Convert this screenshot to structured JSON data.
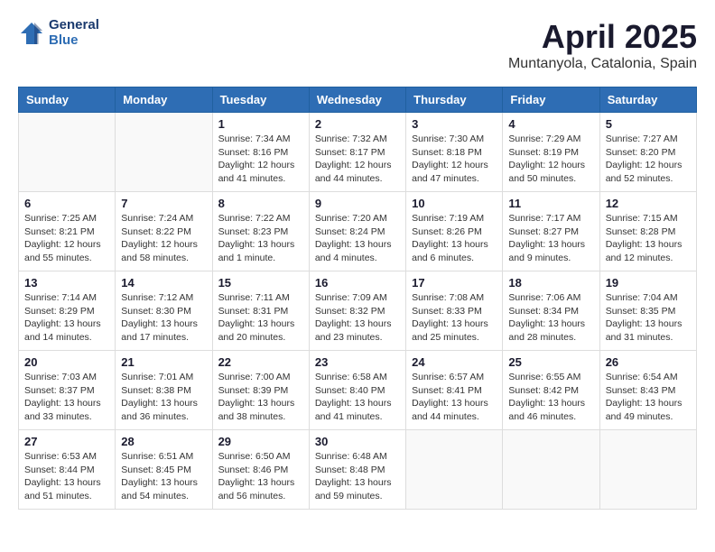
{
  "header": {
    "logo_line1": "General",
    "logo_line2": "Blue",
    "title": "April 2025",
    "subtitle": "Muntanyola, Catalonia, Spain"
  },
  "weekdays": [
    "Sunday",
    "Monday",
    "Tuesday",
    "Wednesday",
    "Thursday",
    "Friday",
    "Saturday"
  ],
  "weeks": [
    [
      {
        "day": "",
        "info": ""
      },
      {
        "day": "",
        "info": ""
      },
      {
        "day": "1",
        "info": "Sunrise: 7:34 AM\nSunset: 8:16 PM\nDaylight: 12 hours and 41 minutes."
      },
      {
        "day": "2",
        "info": "Sunrise: 7:32 AM\nSunset: 8:17 PM\nDaylight: 12 hours and 44 minutes."
      },
      {
        "day": "3",
        "info": "Sunrise: 7:30 AM\nSunset: 8:18 PM\nDaylight: 12 hours and 47 minutes."
      },
      {
        "day": "4",
        "info": "Sunrise: 7:29 AM\nSunset: 8:19 PM\nDaylight: 12 hours and 50 minutes."
      },
      {
        "day": "5",
        "info": "Sunrise: 7:27 AM\nSunset: 8:20 PM\nDaylight: 12 hours and 52 minutes."
      }
    ],
    [
      {
        "day": "6",
        "info": "Sunrise: 7:25 AM\nSunset: 8:21 PM\nDaylight: 12 hours and 55 minutes."
      },
      {
        "day": "7",
        "info": "Sunrise: 7:24 AM\nSunset: 8:22 PM\nDaylight: 12 hours and 58 minutes."
      },
      {
        "day": "8",
        "info": "Sunrise: 7:22 AM\nSunset: 8:23 PM\nDaylight: 13 hours and 1 minute."
      },
      {
        "day": "9",
        "info": "Sunrise: 7:20 AM\nSunset: 8:24 PM\nDaylight: 13 hours and 4 minutes."
      },
      {
        "day": "10",
        "info": "Sunrise: 7:19 AM\nSunset: 8:26 PM\nDaylight: 13 hours and 6 minutes."
      },
      {
        "day": "11",
        "info": "Sunrise: 7:17 AM\nSunset: 8:27 PM\nDaylight: 13 hours and 9 minutes."
      },
      {
        "day": "12",
        "info": "Sunrise: 7:15 AM\nSunset: 8:28 PM\nDaylight: 13 hours and 12 minutes."
      }
    ],
    [
      {
        "day": "13",
        "info": "Sunrise: 7:14 AM\nSunset: 8:29 PM\nDaylight: 13 hours and 14 minutes."
      },
      {
        "day": "14",
        "info": "Sunrise: 7:12 AM\nSunset: 8:30 PM\nDaylight: 13 hours and 17 minutes."
      },
      {
        "day": "15",
        "info": "Sunrise: 7:11 AM\nSunset: 8:31 PM\nDaylight: 13 hours and 20 minutes."
      },
      {
        "day": "16",
        "info": "Sunrise: 7:09 AM\nSunset: 8:32 PM\nDaylight: 13 hours and 23 minutes."
      },
      {
        "day": "17",
        "info": "Sunrise: 7:08 AM\nSunset: 8:33 PM\nDaylight: 13 hours and 25 minutes."
      },
      {
        "day": "18",
        "info": "Sunrise: 7:06 AM\nSunset: 8:34 PM\nDaylight: 13 hours and 28 minutes."
      },
      {
        "day": "19",
        "info": "Sunrise: 7:04 AM\nSunset: 8:35 PM\nDaylight: 13 hours and 31 minutes."
      }
    ],
    [
      {
        "day": "20",
        "info": "Sunrise: 7:03 AM\nSunset: 8:37 PM\nDaylight: 13 hours and 33 minutes."
      },
      {
        "day": "21",
        "info": "Sunrise: 7:01 AM\nSunset: 8:38 PM\nDaylight: 13 hours and 36 minutes."
      },
      {
        "day": "22",
        "info": "Sunrise: 7:00 AM\nSunset: 8:39 PM\nDaylight: 13 hours and 38 minutes."
      },
      {
        "day": "23",
        "info": "Sunrise: 6:58 AM\nSunset: 8:40 PM\nDaylight: 13 hours and 41 minutes."
      },
      {
        "day": "24",
        "info": "Sunrise: 6:57 AM\nSunset: 8:41 PM\nDaylight: 13 hours and 44 minutes."
      },
      {
        "day": "25",
        "info": "Sunrise: 6:55 AM\nSunset: 8:42 PM\nDaylight: 13 hours and 46 minutes."
      },
      {
        "day": "26",
        "info": "Sunrise: 6:54 AM\nSunset: 8:43 PM\nDaylight: 13 hours and 49 minutes."
      }
    ],
    [
      {
        "day": "27",
        "info": "Sunrise: 6:53 AM\nSunset: 8:44 PM\nDaylight: 13 hours and 51 minutes."
      },
      {
        "day": "28",
        "info": "Sunrise: 6:51 AM\nSunset: 8:45 PM\nDaylight: 13 hours and 54 minutes."
      },
      {
        "day": "29",
        "info": "Sunrise: 6:50 AM\nSunset: 8:46 PM\nDaylight: 13 hours and 56 minutes."
      },
      {
        "day": "30",
        "info": "Sunrise: 6:48 AM\nSunset: 8:48 PM\nDaylight: 13 hours and 59 minutes."
      },
      {
        "day": "",
        "info": ""
      },
      {
        "day": "",
        "info": ""
      },
      {
        "day": "",
        "info": ""
      }
    ]
  ]
}
